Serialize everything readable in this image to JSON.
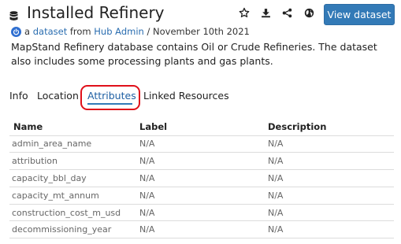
{
  "header": {
    "title": "Installed Refinery",
    "view_button": "View dataset",
    "icons": [
      "database-icon",
      "star-icon",
      "download-icon",
      "share-icon",
      "globe-icon"
    ]
  },
  "byline": {
    "prefix": "a",
    "type_link": "dataset",
    "from": "from",
    "author_link": "Hub Admin",
    "date": "/ November 10th 2021"
  },
  "description": "MapStand Refinery database contains Oil or Crude Refineries. The dataset also includes some processing plants and gas plants.",
  "tabs": [
    {
      "label": "Info",
      "active": false
    },
    {
      "label": "Location",
      "active": false
    },
    {
      "label": "Attributes",
      "active": true
    },
    {
      "label": "Linked Resources",
      "active": false
    }
  ],
  "table": {
    "headers": [
      "Name",
      "Label",
      "Description"
    ],
    "rows": [
      [
        "admin_area_name",
        "N/A",
        "N/A"
      ],
      [
        "attribution",
        "N/A",
        "N/A"
      ],
      [
        "capacity_bbl_day",
        "N/A",
        "N/A"
      ],
      [
        "capacity_mt_annum",
        "N/A",
        "N/A"
      ],
      [
        "construction_cost_m_usd",
        "N/A",
        "N/A"
      ],
      [
        "decommissioning_year",
        "N/A",
        "N/A"
      ]
    ]
  },
  "colors": {
    "accent": "#337ab7",
    "highlight_circle": "#e0101a"
  }
}
